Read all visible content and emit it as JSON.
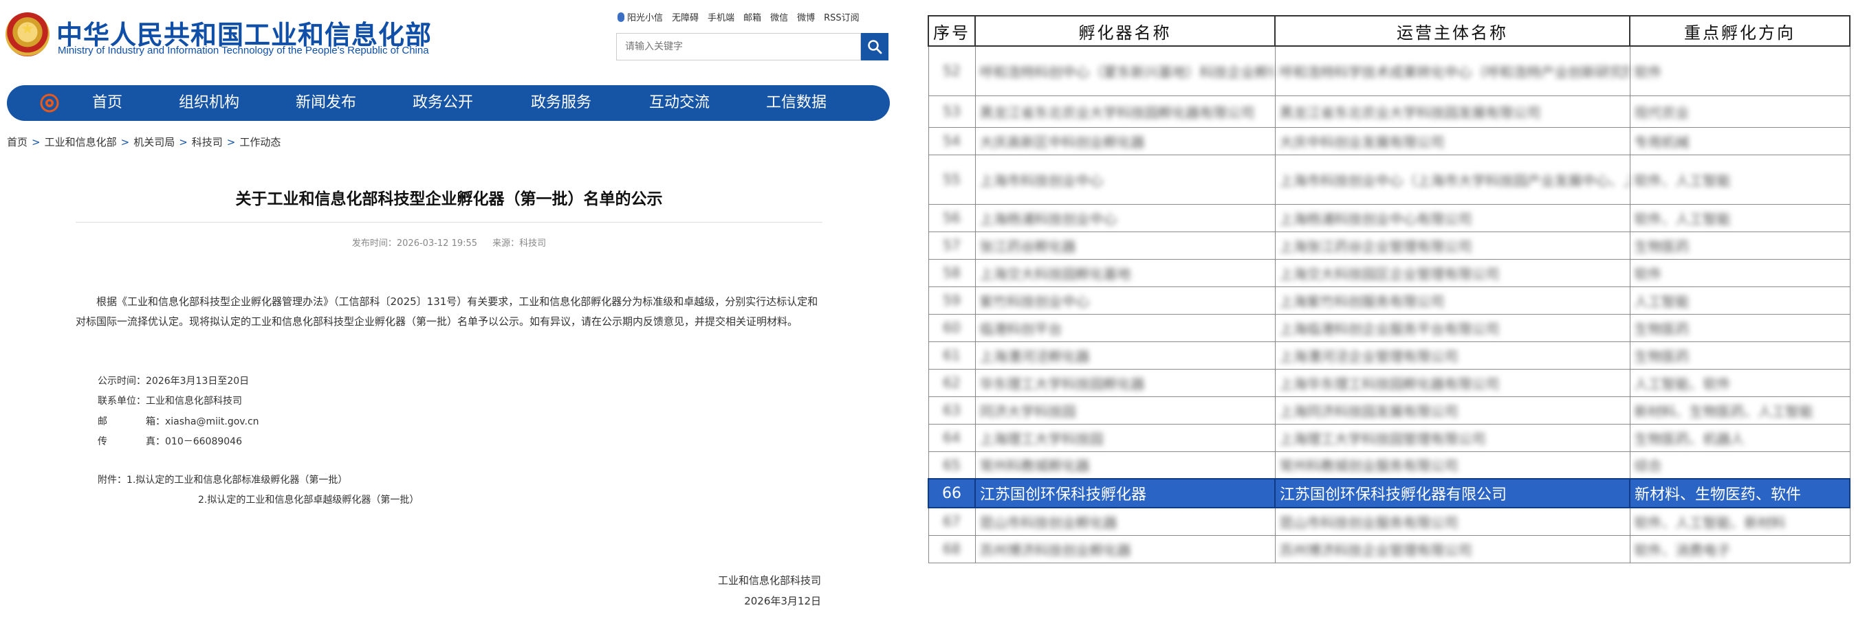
{
  "header": {
    "org_name_cn": "中华人民共和国工业和信息化部",
    "org_name_en": "Ministry of Industry and Information Technology of the People's Republic of China",
    "top_links": [
      "阳光小信",
      "无障碍",
      "手机端",
      "邮箱",
      "微信",
      "微博",
      "RSS订阅"
    ],
    "search_placeholder": "请输入关键字"
  },
  "nav": [
    "首页",
    "组织机构",
    "新闻发布",
    "政务公开",
    "政务服务",
    "互动交流",
    "工信数据"
  ],
  "breadcrumb": [
    "首页",
    "工业和信息化部",
    "机关司局",
    "科技司",
    "工作动态"
  ],
  "article": {
    "title": "关于工业和信息化部科技型企业孵化器（第一批）名单的公示",
    "publish_time": "发布时间：2026-03-12 19:55",
    "source": "来源：科技司",
    "paragraph": "根据《工业和信息化部科技型企业孵化器管理办法》（工信部科〔2025〕131号）有关要求，工业和信息化部孵化器分为标准级和卓越级，分别实行达标认定和对标国际一流择优认定。现将拟认定的工业和信息化部科技型企业孵化器（第一批）名单予以公示。如有异议，请在公示期内反馈意见，并提交相关证明材料。",
    "notice_period": "公示时间：2026年3月13日至20日",
    "contact_unit": "联系单位：工业和信息化部科技司",
    "email_label": "邮　　　　箱：",
    "email": "xiasha@miit.gov.cn",
    "fax_label": "传　　　　真：",
    "fax": "010－66089046",
    "attachment_1": "附件：1.拟认定的工业和信息化部标准级孵化器（第一批）",
    "attachment_2": "2.拟认定的工业和信息化部卓越级孵化器（第一批）",
    "signature": "工业和信息化部科技司",
    "date": "2026年3月12日"
  },
  "table": {
    "headers": [
      "序号",
      "孵化器名称",
      "运营主体名称",
      "重点孵化方向"
    ],
    "blurred_rows": [
      {
        "no": "52",
        "name": "呼和浩特科创中心（蒙东新兴基地）科技企业孵化器",
        "operator": "呼和浩特科学技术成果转化中心（呼和浩特产业创新研究院）",
        "focus": "软件"
      },
      {
        "no": "53",
        "name": "黑龙江省东北农业大学科技园孵化器有限公司",
        "operator": "黑龙江省东北农业大学科技园发展有限公司",
        "focus": "现代农业"
      },
      {
        "no": "54",
        "name": "大庆高新区中科创业孵化器",
        "operator": "大庆中科创业发展有限公司",
        "focus": "专用机械"
      },
      {
        "no": "55",
        "name": "上海市科技创业中心",
        "operator": "上海市科技创业中心（上海市大学科技园产业发展中心、上海市高新技术成果转化服务中心）",
        "focus": "软件、人工智能"
      },
      {
        "no": "56",
        "name": "上海杨浦科技创业中心",
        "operator": "上海杨浦科技创业中心有限公司",
        "focus": "软件、人工智能"
      },
      {
        "no": "57",
        "name": "张江药谷孵化器",
        "operator": "上海张江药谷企业管理有限公司",
        "focus": "生物医药"
      },
      {
        "no": "58",
        "name": "上海交大科技园孵化基地",
        "operator": "上海交大科技园区企业管理有限公司",
        "focus": "软件"
      },
      {
        "no": "59",
        "name": "紫竹科技创业中心",
        "operator": "上海紫竹科创服务有限公司",
        "focus": "人工智能"
      },
      {
        "no": "60",
        "name": "临港科创平台",
        "operator": "上海临港科创企业服务平台有限公司",
        "focus": "生物医药"
      },
      {
        "no": "61",
        "name": "上海漕河泾孵化器",
        "operator": "上海漕河泾企业管理有限公司",
        "focus": "生物医药"
      },
      {
        "no": "62",
        "name": "华东理工大学科技园孵化器",
        "operator": "上海华东理工科技园孵化器有限公司",
        "focus": "人工智能、软件"
      },
      {
        "no": "63",
        "name": "同济大学科技园",
        "operator": "上海同济科技园发展有限公司",
        "focus": "新材料、生物医药、人工智能"
      },
      {
        "no": "64",
        "name": "上海理工大学科技园",
        "operator": "上海理工大学科技园管理有限公司",
        "focus": "生物医药、机器人"
      },
      {
        "no": "65",
        "name": "常州科教城孵化器",
        "operator": "常州科教城创业服务有限公司",
        "focus": "综合"
      }
    ],
    "highlight_row": {
      "no": "66",
      "name": "江苏国创环保科技孵化器",
      "operator": "江苏国创环保科技孵化器有限公司",
      "focus": "新材料、生物医药、软件"
    },
    "trailing_rows": [
      {
        "no": "67",
        "name": "昆山市科技创业孵化器",
        "operator": "昆山市科技创业服务有限公司",
        "focus": "软件、人工智能、新材料"
      },
      {
        "no": "68",
        "name": "苏州博济科技创业孵化器",
        "operator": "苏州博济科技企业管理有限公司",
        "focus": "软件、消费电子"
      }
    ]
  },
  "colors": {
    "brand_blue": "#1654a6",
    "highlight_blue": "#2a64c4"
  },
  "icons": {
    "search": "search-icon",
    "emblem": "national-emblem-icon",
    "nav_logo": "miit-logo-icon",
    "voice": "microphone-icon"
  }
}
